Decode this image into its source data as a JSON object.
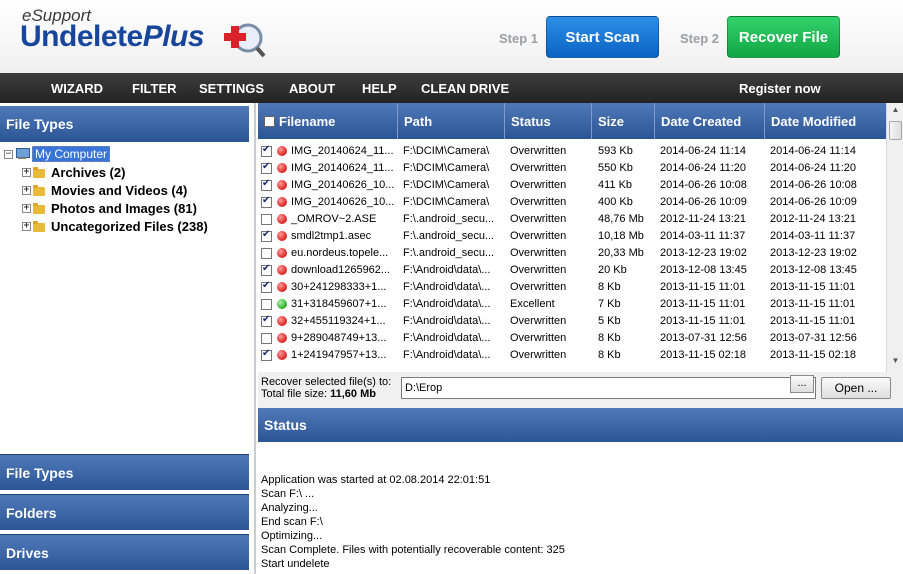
{
  "header": {
    "logo_top": "eSupport",
    "logo_main": "Undelete",
    "logo_plus": "Plus",
    "step1_label": "Step 1",
    "start_scan_label": "Start Scan",
    "step2_label": "Step 2",
    "recover_file_label": "Recover File"
  },
  "menu": {
    "items": [
      "WIZARD",
      "FILTER",
      "SETTINGS",
      "ABOUT",
      "HELP",
      "CLEAN DRIVE"
    ],
    "register": "Register now"
  },
  "left_panel": {
    "title": "File Types",
    "root": "My Computer",
    "children": [
      "Archives (2)",
      "Movies and Videos (4)",
      "Photos and Images (81)",
      "Uncategorized Files (238)"
    ],
    "bottom_tabs": [
      "File Types",
      "Folders",
      "Drives"
    ]
  },
  "table": {
    "columns": [
      "Filename",
      "Path",
      "Status",
      "Size",
      "Date Created",
      "Date Modified"
    ],
    "rows": [
      {
        "checked": true,
        "status_color": "red",
        "filename": "IMG_20140624_11...",
        "path": "F:\\DCIM\\Camera\\",
        "status": "Overwritten",
        "size": "593 Kb",
        "created": "2014-06-24 11:14",
        "modified": "2014-06-24 11:14"
      },
      {
        "checked": true,
        "status_color": "red",
        "filename": "IMG_20140624_11...",
        "path": "F:\\DCIM\\Camera\\",
        "status": "Overwritten",
        "size": "550 Kb",
        "created": "2014-06-24 11:20",
        "modified": "2014-06-24 11:20"
      },
      {
        "checked": true,
        "status_color": "red",
        "filename": "IMG_20140626_10...",
        "path": "F:\\DCIM\\Camera\\",
        "status": "Overwritten",
        "size": "411 Kb",
        "created": "2014-06-26 10:08",
        "modified": "2014-06-26 10:08"
      },
      {
        "checked": true,
        "status_color": "red",
        "filename": "IMG_20140626_10...",
        "path": "F:\\DCIM\\Camera\\",
        "status": "Overwritten",
        "size": "400 Kb",
        "created": "2014-06-26 10:09",
        "modified": "2014-06-26 10:09"
      },
      {
        "checked": false,
        "status_color": "red",
        "filename": "_OMROV~2.ASE",
        "path": "F:\\.android_secu...",
        "status": "Overwritten",
        "size": "48,76 Mb",
        "created": "2012-11-24 13:21",
        "modified": "2012-11-24 13:21"
      },
      {
        "checked": true,
        "status_color": "red",
        "filename": "smdl2tmp1.asec",
        "path": "F:\\.android_secu...",
        "status": "Overwritten",
        "size": "10,18 Mb",
        "created": "2014-03-11 11:37",
        "modified": "2014-03-11 11:37"
      },
      {
        "checked": false,
        "status_color": "red",
        "filename": "eu.nordeus.topele...",
        "path": "F:\\.android_secu...",
        "status": "Overwritten",
        "size": "20,33 Mb",
        "created": "2013-12-23 19:02",
        "modified": "2013-12-23 19:02"
      },
      {
        "checked": true,
        "status_color": "red",
        "filename": "download1265962...",
        "path": "F:\\Android\\data\\...",
        "status": "Overwritten",
        "size": "20 Kb",
        "created": "2013-12-08 13:45",
        "modified": "2013-12-08 13:45"
      },
      {
        "checked": true,
        "status_color": "red",
        "filename": "30+241298333+1...",
        "path": "F:\\Android\\data\\...",
        "status": "Overwritten",
        "size": "8 Kb",
        "created": "2013-11-15 11:01",
        "modified": "2013-11-15 11:01"
      },
      {
        "checked": false,
        "status_color": "green",
        "filename": "31+318459607+1...",
        "path": "F:\\Android\\data\\...",
        "status": "Excellent",
        "size": "7 Kb",
        "created": "2013-11-15 11:01",
        "modified": "2013-11-15 11:01"
      },
      {
        "checked": true,
        "status_color": "red",
        "filename": "32+455119324+1...",
        "path": "F:\\Android\\data\\...",
        "status": "Overwritten",
        "size": "5 Kb",
        "created": "2013-11-15 11:01",
        "modified": "2013-11-15 11:01"
      },
      {
        "checked": false,
        "status_color": "red",
        "filename": "9+289048749+13...",
        "path": "F:\\Android\\data\\...",
        "status": "Overwritten",
        "size": "8 Kb",
        "created": "2013-07-31 12:56",
        "modified": "2013-07-31 12:56"
      },
      {
        "checked": true,
        "status_color": "red",
        "filename": "1+241947957+13...",
        "path": "F:\\Android\\data\\...",
        "status": "Overwritten",
        "size": "8 Kb",
        "created": "2013-11-15 02:18",
        "modified": "2013-11-15 02:18"
      }
    ]
  },
  "recover": {
    "label_line1": "Recover selected file(s) to:",
    "label_line2": "Total file size:",
    "total_size": "11,60 Mb",
    "path_value": "D:\\Erop",
    "browse_label": "...",
    "open_label": "Open ..."
  },
  "status": {
    "title": "Status",
    "log": [
      "Application was started at 02.08.2014 22:01:51",
      "Scan F:\\ ...",
      "Analyzing...",
      "End scan F:\\",
      "Optimizing...",
      "Scan Complete. Files with potentially recoverable content: 325",
      "Start undelete"
    ]
  },
  "colors": {
    "accent_blue": "#2c5595",
    "start_scan": "#0b63c4",
    "recover_file": "#12a545",
    "menu_bar": "#2b2b2b"
  }
}
